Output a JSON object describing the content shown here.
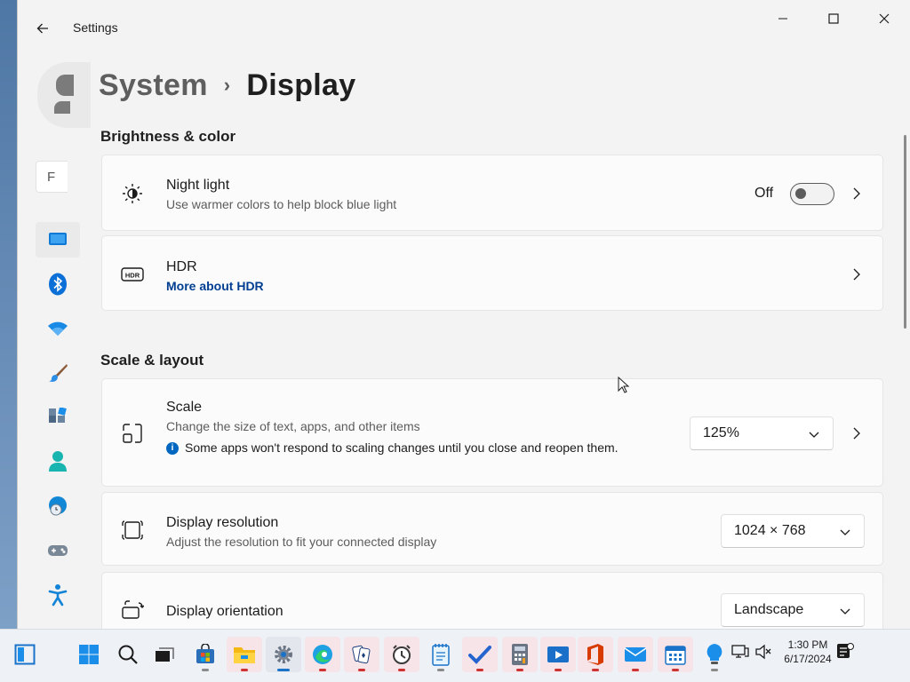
{
  "window": {
    "app_title": "Settings",
    "search_placeholder": "F"
  },
  "breadcrumb": {
    "parent": "System",
    "separator": "›",
    "current": "Display"
  },
  "sections": {
    "brightness": "Brightness & color",
    "scale_layout": "Scale & layout"
  },
  "night_light": {
    "title": "Night light",
    "subtitle": "Use warmer colors to help block blue light",
    "state_label": "Off",
    "is_on": false
  },
  "hdr": {
    "title": "HDR",
    "link": "More about HDR"
  },
  "scale": {
    "title": "Scale",
    "subtitle": "Change the size of text, apps, and other items",
    "note": "Some apps won't respond to scaling changes until you close and reopen them.",
    "value": "125%"
  },
  "resolution": {
    "title": "Display resolution",
    "subtitle": "Adjust the resolution to fit your connected display",
    "value": "1024 × 768"
  },
  "orientation": {
    "title": "Display orientation",
    "value": "Landscape"
  },
  "nav_icons": [
    "display-icon",
    "bluetooth-icon",
    "wifi-icon",
    "personalization-brush-icon",
    "apps-icon",
    "accounts-icon",
    "time-language-icon",
    "gaming-icon",
    "accessibility-icon"
  ],
  "taskbar": {
    "apps": [
      "widgets-icon",
      "start-icon",
      "search-icon",
      "task-view-icon",
      "store-icon",
      "file-explorer-icon",
      "settings-icon",
      "edge-icon",
      "solitaire-icon",
      "clock-icon",
      "notepad-icon",
      "todo-icon",
      "calculator-icon",
      "media-player-icon",
      "office-icon",
      "mail-icon",
      "calendar-icon",
      "tips-icon"
    ],
    "time": "1:30 PM",
    "date": "6/17/2024"
  },
  "colors": {
    "accent": "#005fb8",
    "link": "#003e92",
    "background": "#f3f3f3",
    "card": "#fbfbfb"
  }
}
